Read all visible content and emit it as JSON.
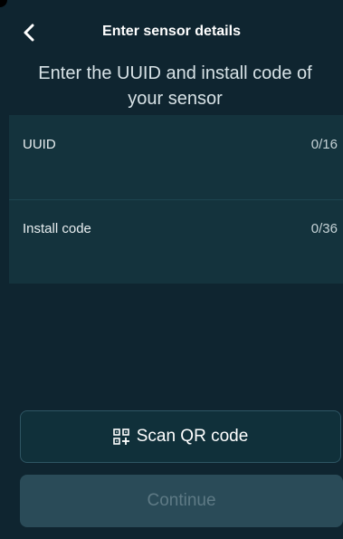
{
  "header": {
    "title": "Enter sensor details",
    "back_icon": "chevron-left-icon"
  },
  "subtitle": "Enter the UUID and install code of\nyour sensor",
  "fields": [
    {
      "label": "UUID",
      "value": "",
      "counter": "0/16"
    },
    {
      "label": "Install code",
      "value": "",
      "counter": "0/36"
    }
  ],
  "actions": {
    "scan_label": "Scan QR code",
    "scan_icon": "qr-code-icon",
    "continue_label": "Continue",
    "continue_enabled": false
  },
  "colors": {
    "background": "#0f2530",
    "field_background": "#14333d",
    "continue_disabled_bg": "#2a4b58",
    "continue_disabled_text": "#5e7a85"
  }
}
